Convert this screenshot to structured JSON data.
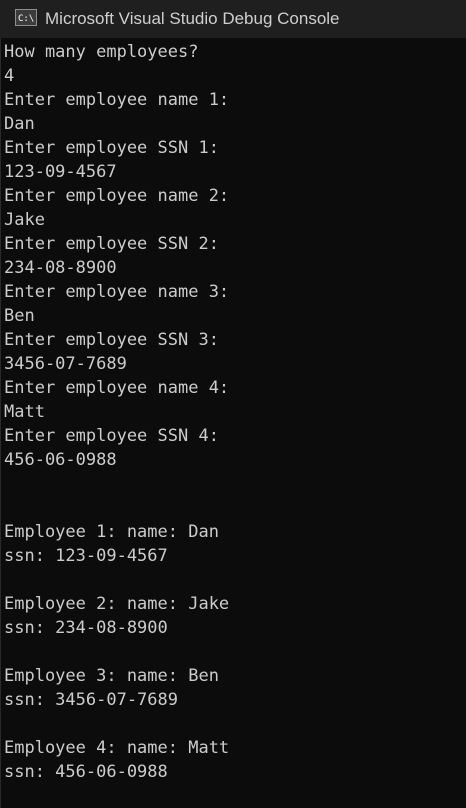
{
  "window": {
    "title": "Microsoft Visual Studio Debug Console",
    "icon": "console-app-icon",
    "colors": {
      "background": "#0c0c0c",
      "titlebar": "#1f1f1f",
      "text": "#cccccc"
    }
  },
  "console": {
    "lines": [
      "How many employees?",
      "4",
      "Enter employee name 1:",
      "Dan",
      "Enter employee SSN 1:",
      "123-09-4567",
      "Enter employee name 2:",
      "Jake",
      "Enter employee SSN 2:",
      "234-08-8900",
      "Enter employee name 3:",
      "Ben",
      "Enter employee SSN 3:",
      "3456-07-7689",
      "Enter employee name 4:",
      "Matt",
      "Enter employee SSN 4:",
      "456-06-0988",
      "",
      "",
      "Employee 1: name: Dan",
      "ssn: 123-09-4567",
      "",
      "Employee 2: name: Jake",
      "ssn: 234-08-8900",
      "",
      "Employee 3: name: Ben",
      "ssn: 3456-07-7689",
      "",
      "Employee 4: name: Matt",
      "ssn: 456-06-0988"
    ]
  }
}
